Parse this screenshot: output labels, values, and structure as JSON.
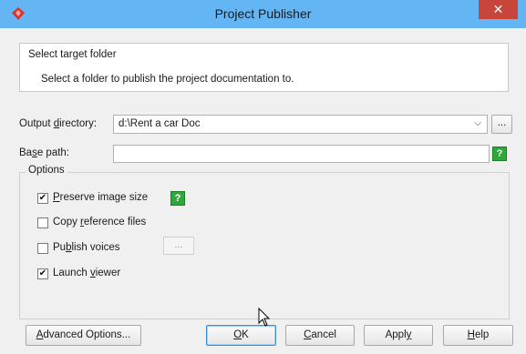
{
  "window": {
    "title": "Project Publisher",
    "close_label": "✕"
  },
  "header": {
    "title": "Select target folder",
    "description": "Select a folder to publish the project documentation to."
  },
  "output_directory": {
    "label_pre": "Output ",
    "label_mnemonic": "d",
    "label_post": "irectory:",
    "value": "d:\\Rent a car Doc",
    "browse_label": "..."
  },
  "base_path": {
    "label_pre": "Ba",
    "label_mnemonic": "s",
    "label_post": "e path:",
    "value": "",
    "help_label": "?"
  },
  "options": {
    "title": "Options",
    "preserve_image_size": {
      "pre": "",
      "mnemonic": "P",
      "post": "reserve image size",
      "checked": true,
      "help_label": "?"
    },
    "copy_reference_files": {
      "pre": "Copy ",
      "mnemonic": "r",
      "post": "eference files",
      "checked": false
    },
    "publish_voices": {
      "pre": "Pu",
      "mnemonic": "b",
      "post": "lish voices",
      "checked": false,
      "ellipsis_label": "..."
    },
    "launch_viewer": {
      "pre": "Launch ",
      "mnemonic": "v",
      "post": "iewer",
      "checked": true
    },
    "check_mark": "✔"
  },
  "buttons": {
    "advanced": {
      "pre": "",
      "mnemonic": "A",
      "post": "dvanced Options..."
    },
    "ok": {
      "pre": "",
      "mnemonic": "O",
      "post": "K"
    },
    "cancel": {
      "pre": "",
      "mnemonic": "C",
      "post": "ancel"
    },
    "apply": {
      "pre": "Appl",
      "mnemonic": "y",
      "post": ""
    },
    "help": {
      "pre": "",
      "mnemonic": "H",
      "post": "elp"
    }
  },
  "colors": {
    "titlebar": "#64b5f4",
    "close_button": "#c7453a",
    "help_icon": "#2fa83a",
    "default_button_border": "#3c8ed6"
  },
  "icons": {
    "app": "visual-paradigm-logo-icon",
    "close": "close-icon",
    "dropdown": "chevron-down-icon",
    "help": "help-icon",
    "cursor": "mouse-pointer-icon"
  }
}
